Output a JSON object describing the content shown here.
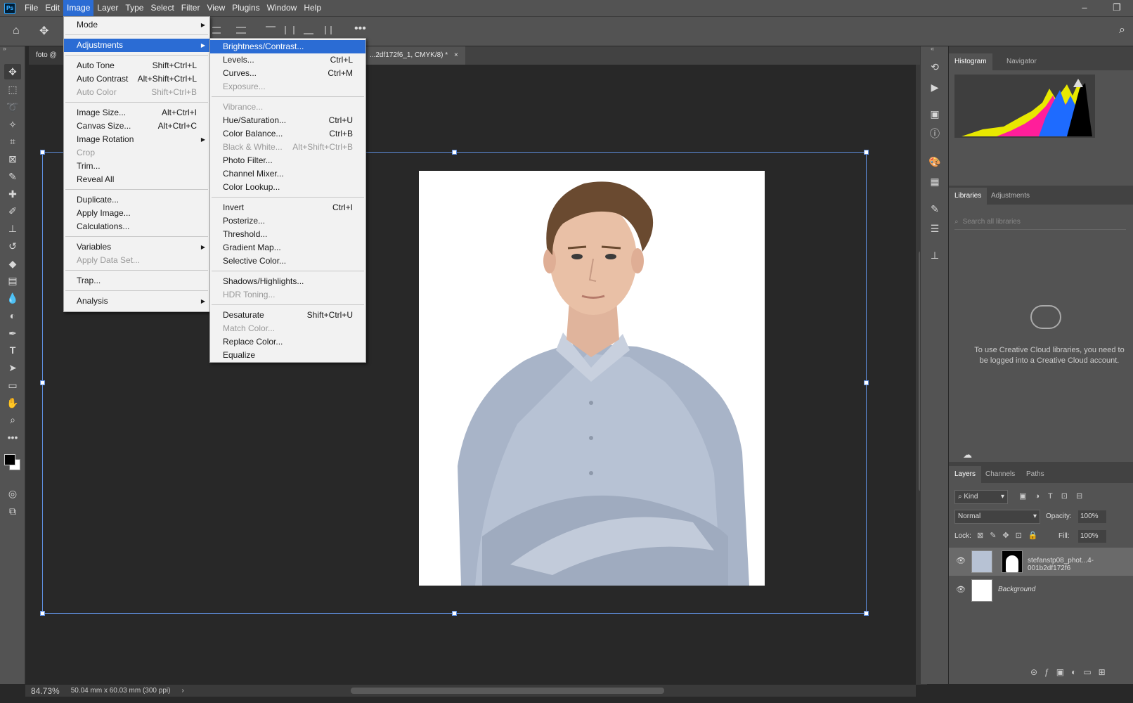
{
  "app": {
    "logo": "Ps"
  },
  "menubar": [
    "File",
    "Edit",
    "Image",
    "Layer",
    "Type",
    "Select",
    "Filter",
    "View",
    "Plugins",
    "Window",
    "Help"
  ],
  "window_controls": {
    "minimize": "–",
    "restore": "❐"
  },
  "doc_tabs": {
    "tab1": "foto @ 84",
    "tab2": "...2df172f6_1, CMYK/8) *",
    "tab2_close": "×"
  },
  "image_menu": {
    "items": [
      {
        "label": "Mode",
        "submenu": true
      },
      {
        "label": "Adjustments",
        "submenu": true,
        "highlighted": true
      },
      {
        "label": "Auto Tone",
        "shortcut": "Shift+Ctrl+L"
      },
      {
        "label": "Auto Contrast",
        "shortcut": "Alt+Shift+Ctrl+L"
      },
      {
        "label": "Auto Color",
        "shortcut": "Shift+Ctrl+B",
        "disabled": true
      },
      {
        "label": "Image Size...",
        "shortcut": "Alt+Ctrl+I"
      },
      {
        "label": "Canvas Size...",
        "shortcut": "Alt+Ctrl+C"
      },
      {
        "label": "Image Rotation",
        "submenu": true
      },
      {
        "label": "Crop",
        "disabled": true
      },
      {
        "label": "Trim..."
      },
      {
        "label": "Reveal All"
      },
      {
        "label": "Duplicate..."
      },
      {
        "label": "Apply Image..."
      },
      {
        "label": "Calculations..."
      },
      {
        "label": "Variables",
        "submenu": true
      },
      {
        "label": "Apply Data Set...",
        "disabled": true
      },
      {
        "label": "Trap..."
      },
      {
        "label": "Analysis",
        "submenu": true
      }
    ]
  },
  "adjustments_menu": {
    "items": [
      {
        "label": "Brightness/Contrast...",
        "highlighted": true
      },
      {
        "label": "Levels...",
        "shortcut": "Ctrl+L"
      },
      {
        "label": "Curves...",
        "shortcut": "Ctrl+M"
      },
      {
        "label": "Exposure...",
        "disabled": true
      },
      {
        "label": "Vibrance...",
        "disabled": true
      },
      {
        "label": "Hue/Saturation...",
        "shortcut": "Ctrl+U"
      },
      {
        "label": "Color Balance...",
        "shortcut": "Ctrl+B"
      },
      {
        "label": "Black & White...",
        "shortcut": "Alt+Shift+Ctrl+B",
        "disabled": true
      },
      {
        "label": "Photo Filter..."
      },
      {
        "label": "Channel Mixer..."
      },
      {
        "label": "Color Lookup..."
      },
      {
        "label": "Invert",
        "shortcut": "Ctrl+I"
      },
      {
        "label": "Posterize..."
      },
      {
        "label": "Threshold..."
      },
      {
        "label": "Gradient Map..."
      },
      {
        "label": "Selective Color..."
      },
      {
        "label": "Shadows/Highlights..."
      },
      {
        "label": "HDR Toning...",
        "disabled": true
      },
      {
        "label": "Desaturate",
        "shortcut": "Shift+Ctrl+U"
      },
      {
        "label": "Match Color...",
        "disabled": true
      },
      {
        "label": "Replace Color..."
      },
      {
        "label": "Equalize"
      }
    ]
  },
  "status": {
    "zoom": "84.73%",
    "doc_info": "50.04 mm x 60.03 mm (300 ppi)",
    "arrow": "›"
  },
  "panels": {
    "histogram_tab": "Histogram",
    "navigator_tab": "Navigator",
    "libraries_tab": "Libraries",
    "adjustments_tab": "Adjustments",
    "library_search_placeholder": "Search all libraries",
    "cc_message": "To use Creative Cloud libraries, you need to be logged into a Creative Cloud account.",
    "layers_tab": "Layers",
    "channels_tab": "Channels",
    "paths_tab": "Paths",
    "kind_filter": "Kind",
    "blend_mode": "Normal",
    "opacity_label": "Opacity:",
    "opacity_value": "100%",
    "lock_label": "Lock:",
    "fill_label": "Fill:",
    "fill_value": "100%",
    "layers": [
      {
        "name": "stefanstp08_phot...4-001b2df172f6"
      },
      {
        "name": "Background"
      }
    ]
  },
  "colors": {
    "accent": "#2b6cd4",
    "frame": "#5f8fe0",
    "ui_bg": "#535353"
  }
}
